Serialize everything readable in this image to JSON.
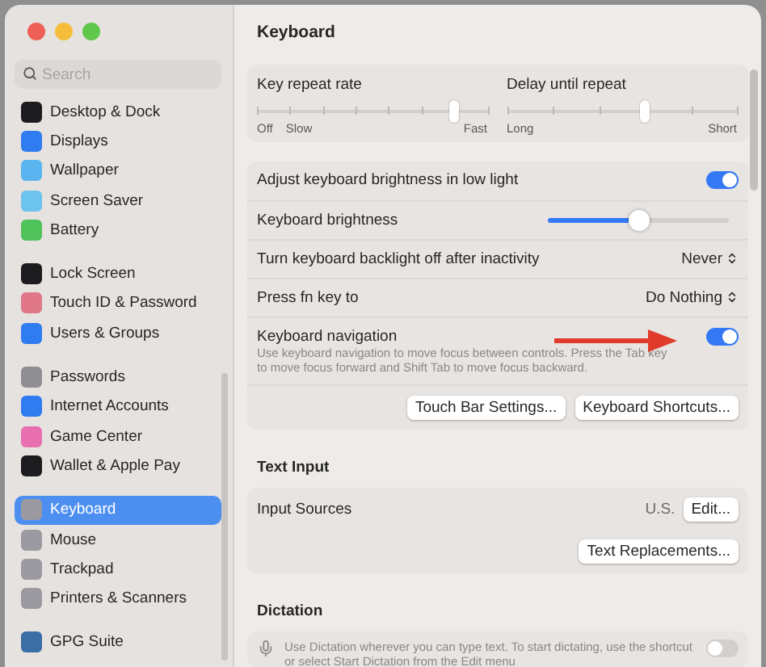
{
  "sidebar": {
    "search": {
      "placeholder": "Search"
    },
    "groups": [
      {
        "items": [
          {
            "label": "Desktop & Dock",
            "color": "#1c1c1e",
            "selected": false
          },
          {
            "label": "Displays",
            "color": "#2f7cf0",
            "selected": false
          },
          {
            "label": "Wallpaper",
            "color": "#5ab4f0",
            "selected": false
          },
          {
            "label": "Screen Saver",
            "color": "#6cc3ee",
            "selected": false
          },
          {
            "label": "Battery",
            "color": "#4fc25a",
            "selected": false
          }
        ]
      },
      {
        "items": [
          {
            "label": "Lock Screen",
            "color": "#1c1c1e",
            "selected": false
          },
          {
            "label": "Touch ID & Password",
            "color": "#e0788a",
            "selected": false
          },
          {
            "label": "Users & Groups",
            "color": "#2f7cf0",
            "selected": false
          }
        ]
      },
      {
        "items": [
          {
            "label": "Passwords",
            "color": "#8e8e93",
            "selected": false
          },
          {
            "label": "Internet Accounts",
            "color": "#2f7cf0",
            "selected": false
          },
          {
            "label": "Game Center",
            "color": "#e86fb0",
            "selected": false
          },
          {
            "label": "Wallet & Apple Pay",
            "color": "#1c1c1e",
            "selected": false
          }
        ]
      },
      {
        "items": [
          {
            "label": "Keyboard",
            "color": "#9a9aa0",
            "selected": true
          },
          {
            "label": "Mouse",
            "color": "#9a9aa0",
            "selected": false
          },
          {
            "label": "Trackpad",
            "color": "#9a9aa0",
            "selected": false
          },
          {
            "label": "Printers & Scanners",
            "color": "#9a9aa0",
            "selected": false
          }
        ]
      },
      {
        "items": [
          {
            "label": "GPG Suite",
            "color": "#3a6ea5",
            "selected": false
          }
        ]
      }
    ]
  },
  "content": {
    "title": "Keyboard",
    "sliders": [
      {
        "label": "Key repeat rate",
        "level": 0.857,
        "marks": [
          "Off",
          "Slow",
          "Fast"
        ]
      },
      {
        "label": "Delay until repeat",
        "level": 0.6,
        "marks": [
          "Long",
          "Short"
        ]
      }
    ],
    "rows": [
      {
        "kind": "toggle",
        "label": "Adjust keyboard brightness in low light",
        "on": true
      },
      {
        "kind": "slider",
        "label": "Keyboard brightness",
        "level": 0.5
      },
      {
        "kind": "popup",
        "label": "Turn keyboard backlight off after inactivity",
        "value": "Never"
      },
      {
        "kind": "popup",
        "label": "Press fn key to",
        "value": "Do Nothing"
      },
      {
        "kind": "toggle",
        "label": "Keyboard navigation",
        "on": true,
        "annotated": true,
        "description": "Use keyboard navigation to move focus between controls. Press the Tab key to move focus forward and Shift Tab to move focus backward."
      },
      {
        "kind": "buttons",
        "buttons": [
          "Touch Bar Settings...",
          "Keyboard Shortcuts..."
        ]
      }
    ],
    "text_input": {
      "heading": "Text Input",
      "input_sources": {
        "label": "Input Sources",
        "value": "U.S.",
        "button": "Edit..."
      },
      "button": "Text Replacements..."
    },
    "dictation": {
      "heading": "Dictation",
      "description": "Use Dictation wherever you can type text. To start dictating, use the shortcut or select Start Dictation from the Edit menu",
      "on": false
    }
  }
}
